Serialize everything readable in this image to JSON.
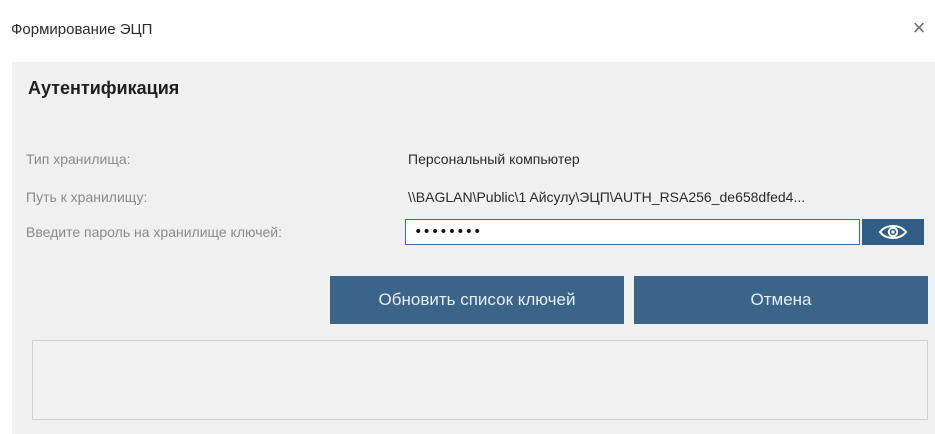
{
  "window": {
    "title": "Формирование ЭЦП",
    "close_symbol": "×"
  },
  "section": {
    "title": "Аутентификация"
  },
  "fields": {
    "storage_type": {
      "label": "Тип хранилища:",
      "value": "Персональный компьютер"
    },
    "storage_path": {
      "label": "Путь к хранилищу:",
      "value": "\\\\BAGLAN\\Public\\1 Aйсулу\\ЭЦП\\AUTH_RSA256_de658dfed4..."
    },
    "password": {
      "label": "Введите пароль на хранилище ключей:",
      "value": "••••••••"
    }
  },
  "buttons": {
    "refresh_label": "Обновить список ключей",
    "cancel_label": "Отмена"
  },
  "colors": {
    "button_bg": "#3a6489",
    "eye_button_bg": "#2f5d86",
    "input_border": "#3a6ea5",
    "panel_bg": "#f0f0f0"
  },
  "icons": {
    "close": "close-icon",
    "eye": "eye-icon"
  }
}
